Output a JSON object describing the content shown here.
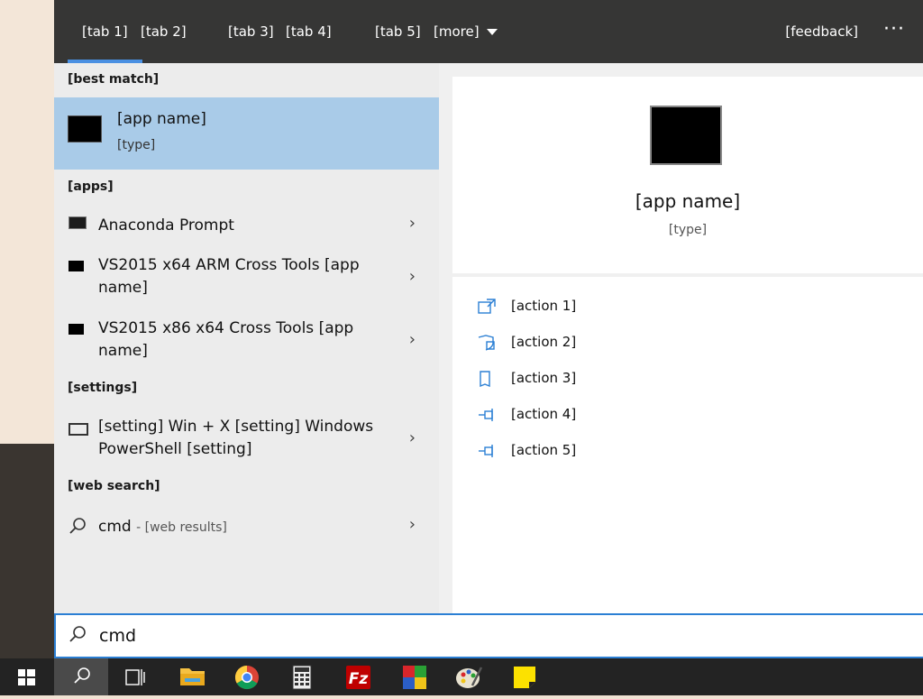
{
  "tabs": [
    {
      "label": "[tab 1]"
    },
    {
      "label": "[tab 2]"
    },
    {
      "label": "[tab 3]"
    },
    {
      "label": "[tab 4]"
    },
    {
      "label": "[tab 5]"
    },
    {
      "label": "[more]"
    }
  ],
  "header": {
    "feedback_label": "[feedback]",
    "more_options": "···"
  },
  "results": {
    "best_match_header": "[best match]",
    "best_match": {
      "title": "[app name]",
      "subtitle": "[type]"
    },
    "apps_header": "[apps]",
    "apps": [
      {
        "label": "Anaconda Prompt",
        "icon": "terminal-icon"
      },
      {
        "label": "VS2015 x64 ARM Cross Tools [app name]",
        "icon": "terminal-icon"
      },
      {
        "label": "VS2015 x86 x64 Cross Tools [app name]",
        "icon": "terminal-icon"
      }
    ],
    "settings_header": "[settings]",
    "settings": [
      {
        "label": "[setting] Win + X [setting] Windows PowerShell [setting]",
        "icon": "keyboard-icon"
      }
    ],
    "web_header": "[web search]",
    "web": {
      "query": "cmd",
      "suffix": "- [web results]",
      "icon": "search-icon"
    }
  },
  "detail": {
    "title": "[app name]",
    "subtitle": "[type]",
    "actions": [
      {
        "label": "[action 1]",
        "icon": "open-icon"
      },
      {
        "label": "[action 2]",
        "icon": "shield-icon"
      },
      {
        "label": "[action 3]",
        "icon": "folder-location-icon"
      },
      {
        "label": "[action 4]",
        "icon": "pin-icon"
      },
      {
        "label": "[action 5]",
        "icon": "pin-icon"
      }
    ]
  },
  "search": {
    "value": "cmd"
  },
  "taskbar": {
    "items": [
      "windows-start-icon",
      "search-icon",
      "task-view-icon",
      "file-explorer-icon",
      "chrome-icon",
      "calculator-icon",
      "filezilla-icon",
      "colorful-app-icon",
      "paint-icon",
      "sticky-notes-icon"
    ]
  },
  "colors": {
    "accent": "#4a90e2",
    "best_match_bg": "#a9cbe8",
    "topbar": "#363635",
    "searchbox_border": "#2b7fd4"
  }
}
